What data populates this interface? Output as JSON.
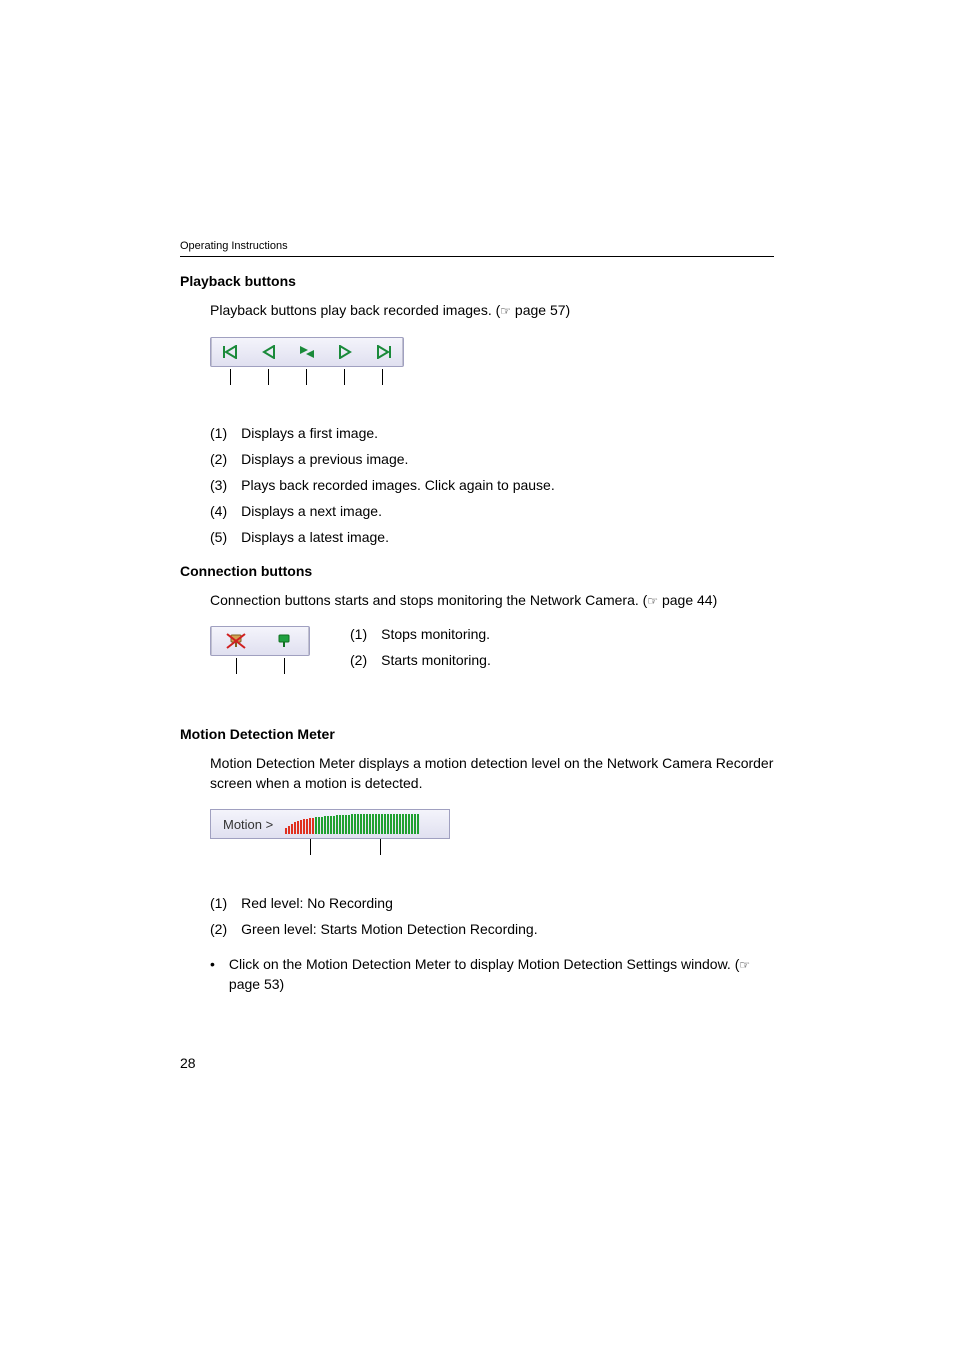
{
  "doc": {
    "header": "Operating Instructions",
    "page_number": "28"
  },
  "playback": {
    "title": "Playback buttons",
    "intro_before": "Playback buttons play back recorded images. (",
    "intro_ref": " page 57)",
    "items": [
      {
        "num": "(1)",
        "text": "Displays a first image."
      },
      {
        "num": "(2)",
        "text": "Displays a previous image."
      },
      {
        "num": "(3)",
        "text": "Plays back recorded images. Click again to pause."
      },
      {
        "num": "(4)",
        "text": "Displays a next image."
      },
      {
        "num": "(5)",
        "text": "Displays a latest image."
      }
    ]
  },
  "connection": {
    "title": "Connection buttons",
    "intro_before": "Connection buttons starts and stops monitoring the Network Camera. (",
    "intro_ref": " page 44)",
    "items": [
      {
        "num": "(1)",
        "text": "Stops monitoring."
      },
      {
        "num": "(2)",
        "text": "Starts monitoring."
      }
    ]
  },
  "motion": {
    "title": "Motion Detection Meter",
    "intro": "Motion Detection Meter displays a motion detection level on the Network Camera Recorder screen when a motion is detected.",
    "label": "Motion >",
    "items": [
      {
        "num": "(1)",
        "text": "Red level: No Recording"
      },
      {
        "num": "(2)",
        "text": "Green level: Starts Motion Detection Recording."
      }
    ],
    "note_before": "Click on the Motion Detection Meter to display Motion Detection Settings window. (",
    "note_ref": " page 53)"
  }
}
